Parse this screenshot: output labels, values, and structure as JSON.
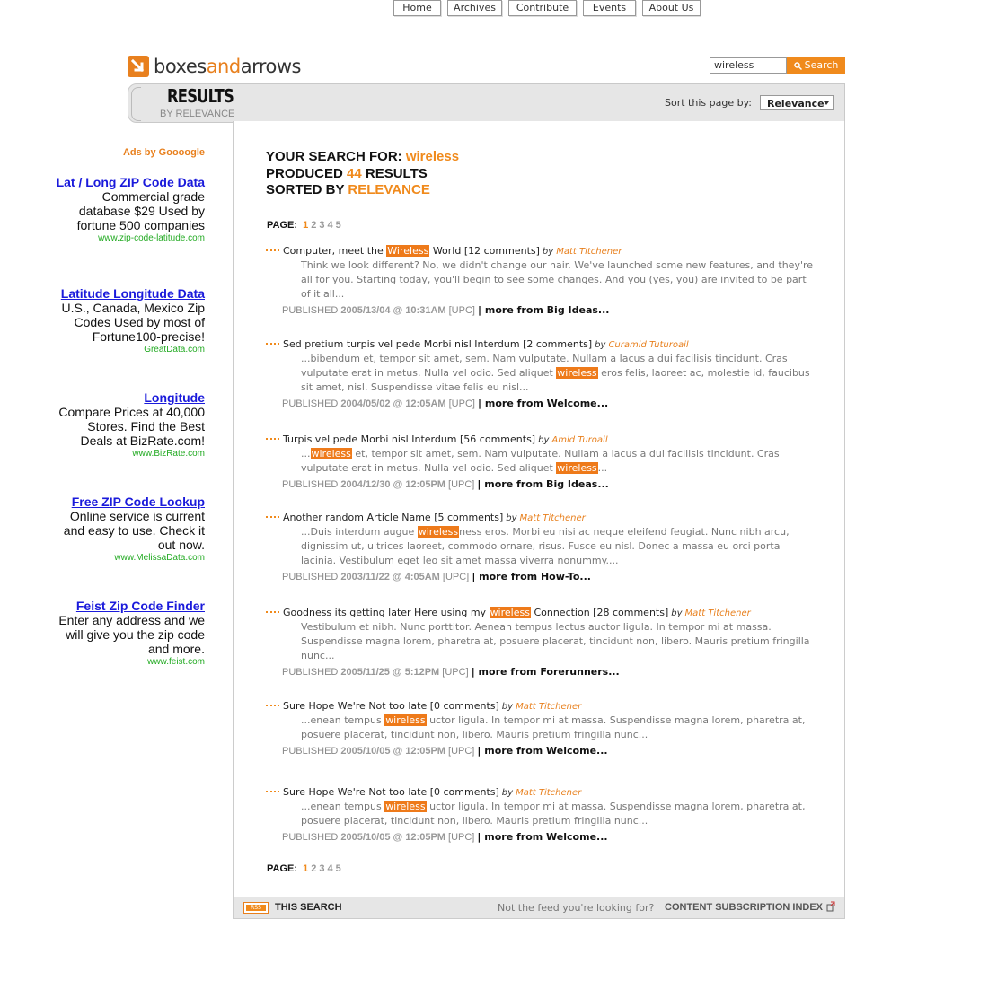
{
  "header": {
    "logo_left": "boxes",
    "logo_mid": "and",
    "logo_right": "arrows",
    "nav": [
      "Home",
      "Archives",
      "Contribute",
      "Events",
      "About Us"
    ],
    "search_value": "wireless",
    "search_button": "Search"
  },
  "banner": {
    "title": "RESULTS",
    "subtitle": "BY RELEVANCE",
    "sort_label": "Sort this page by:",
    "sort_value": "Relevance"
  },
  "summary": {
    "line1_prefix": "YOUR SEARCH FOR:",
    "query": "wireless",
    "line2_prefix": "PRODUCED",
    "count": "44",
    "line2_suffix": "RESULTS",
    "line3_prefix": "SORTED BY",
    "sort": "RELEVANCE"
  },
  "pager": {
    "label": "PAGE:",
    "pages": [
      "1",
      "2",
      "3",
      "4",
      "5"
    ],
    "active": "1"
  },
  "results": [
    {
      "title_before": "Computer, meet the ",
      "title_hl": "Wireless",
      "title_after": " World [12 comments]",
      "by": "by",
      "author": "Matt Titchener",
      "snippet": [
        {
          "t": "Think we look different? No, we didn't change our hair. We've launched some new features, and they're all for you. Starting today, you'll begin to see some changes. And you (yes, you) are invited to be part of it all..."
        }
      ],
      "published": "PUBLISHED",
      "date": "2005/13/04 @ 10:31AM",
      "tz": "[UPC]",
      "more": "| more from Big Ideas..."
    },
    {
      "title_before": "Sed pretium turpis vel pede Morbi nisl Interdum [2 comments]",
      "title_hl": "",
      "title_after": "",
      "by": "by",
      "author": "Curamid Tuturoail",
      "snippet": [
        {
          "t": "...bibendum et, tempor sit amet, sem. Nam vulputate. Nullam a lacus a dui facilisis tincidunt. Cras vulputate erat in metus. Nulla vel odio. Sed aliquet "
        },
        {
          "h": "wireless"
        },
        {
          "t": " eros felis, laoreet ac, molestie id, faucibus sit amet, nisl. Suspendisse vitae felis eu nisl..."
        }
      ],
      "published": "PUBLISHED",
      "date": "2004/05/02 @ 12:05AM",
      "tz": "[UPC]",
      "more": "| more from Welcome..."
    },
    {
      "title_before": "Turpis vel pede Morbi nisl Interdum [56 comments]",
      "title_hl": "",
      "title_after": "",
      "by": "by",
      "author": "Amid Turoail",
      "snippet": [
        {
          "t": "..."
        },
        {
          "h": "wireless"
        },
        {
          "t": " et, tempor sit amet, sem. Nam vulputate. Nullam a lacus a dui facilisis tincidunt. Cras vulputate erat in metus. Nulla vel odio. Sed aliquet "
        },
        {
          "h": "wireless"
        },
        {
          "t": "..."
        }
      ],
      "published": "PUBLISHED",
      "date": "2004/12/30 @ 12:05PM",
      "tz": "[UPC]",
      "more": "| more from Big Ideas..."
    },
    {
      "title_before": "Another random Article Name [5 comments]",
      "title_hl": "",
      "title_after": "",
      "by": "by",
      "author": "Matt Titchener",
      "snippet": [
        {
          "t": "...Duis interdum augue "
        },
        {
          "h": "wireless"
        },
        {
          "t": "ness eros. Morbi eu nisi ac neque eleifend feugiat. Nunc nibh arcu, dignissim ut, ultrices laoreet, commodo ornare, risus. Fusce eu nisl. Donec a massa eu orci porta lacinia. Vestibulum eget leo sit amet massa viverra nonummy...."
        }
      ],
      "published": "PUBLISHED",
      "date": "2003/11/22 @ 4:05AM",
      "tz": "[UPC]",
      "more": " | more from How-To..."
    },
    {
      "title_before": "Goodness its getting later Here using my ",
      "title_hl": "wireless",
      "title_after": " Connection [28 comments]",
      "by": "by",
      "author": "Matt Titchener",
      "snippet": [
        {
          "t": "Vestibulum et nibh. Nunc porttitor. Aenean tempus lectus auctor ligula. In tempor mi at massa. Suspendisse magna lorem, pharetra at, posuere placerat, tincidunt non, libero. Mauris pretium fringilla nunc..."
        }
      ],
      "published": "PUBLISHED",
      "date": "2005/11/25 @ 5:12PM",
      "tz": "[UPC]",
      "more": " | more from Forerunners..."
    },
    {
      "title_before": "Sure Hope We're Not too late [0 comments]",
      "title_hl": "",
      "title_after": "",
      "by": "by",
      "author": "Matt Titchener",
      "snippet": [
        {
          "t": "...enean tempus "
        },
        {
          "h": "wireless"
        },
        {
          "t": " uctor ligula. In tempor mi at massa. Suspendisse magna lorem, pharetra at, posuere placerat, tincidunt non, libero. Mauris pretium fringilla nunc..."
        }
      ],
      "published": "PUBLISHED",
      "date": "2005/10/05 @ 12:05PM",
      "tz": "[UPC]",
      "more": "| more from Welcome..."
    },
    {
      "title_before": "Sure Hope We're Not too late [0 comments]",
      "title_hl": "",
      "title_after": "",
      "by": "by",
      "author": "Matt Titchener",
      "snippet": [
        {
          "t": "...enean tempus "
        },
        {
          "h": "wireless"
        },
        {
          "t": " uctor ligula. In tempor mi at massa. Suspendisse magna lorem, pharetra at, posuere placerat, tincidunt non, libero. Mauris pretium fringilla nunc..."
        }
      ],
      "published": "PUBLISHED",
      "date": "2005/10/05 @ 12:05PM",
      "tz": "[UPC]",
      "more": "| more from Welcome..."
    }
  ],
  "footer": {
    "rss": "RSS",
    "this_search": "THIS SEARCH",
    "not_feed": "Not the feed you're looking for?",
    "index_link": "CONTENT SUBSCRIPTION INDEX"
  },
  "ads": {
    "heading": "Ads by Goooogle",
    "items": [
      {
        "title": "Lat / Long ZIP Code Data",
        "body": "Commercial grade database $29 Used by fortune 500 companies",
        "url": "www.zip-code-latitude.com"
      },
      {
        "title": "Latitude Longitude Data",
        "body": "U.S., Canada, Mexico Zip Codes Used by most of Fortune100-precise!",
        "url": "GreatData.com"
      },
      {
        "title": "Longitude",
        "body": "Compare Prices at 40,000 Stores. Find the Best Deals at BizRate.com!",
        "url": "www.BizRate.com"
      },
      {
        "title": "Free ZIP Code Lookup",
        "body": "Online service is current and easy to use. Check it out now.",
        "url": "www.MelissaData.com"
      },
      {
        "title": "Feist Zip Code Finder",
        "body": "Enter any address and we will give you the zip code and more.",
        "url": "www.feist.com"
      }
    ]
  },
  "colors": {
    "accent": "#f08a1c",
    "link_blue": "#1a1adb",
    "ad_url_green": "#22aa22"
  }
}
